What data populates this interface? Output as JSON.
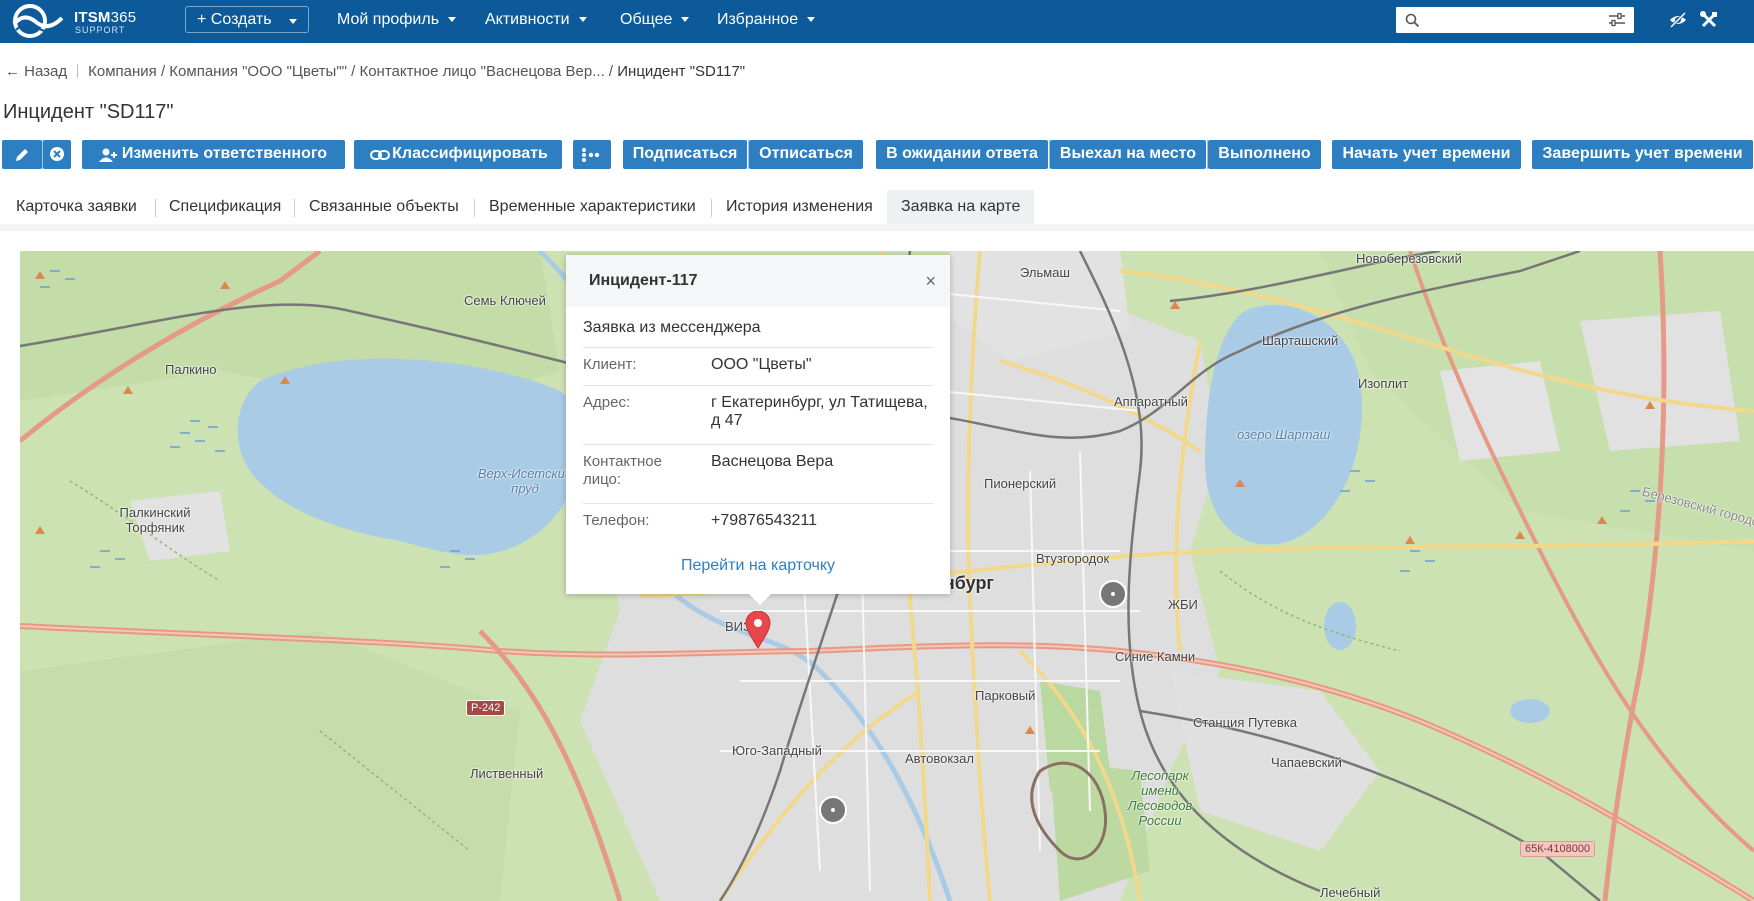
{
  "header": {
    "brand": "ITSM",
    "brand_num": "365",
    "brand_sub": "SUPPORT",
    "create_label": "+ Создать",
    "nav": [
      "Мой профиль",
      "Активности",
      "Общее",
      "Избранное"
    ],
    "search_placeholder": ""
  },
  "breadcrumb": {
    "back": "← Назад",
    "path": "Компания / Компания \"ООО \"Цветы\"\" / Контактное лицо \"Васнецова Вер... / ",
    "current": "Инцидент \"SD117\""
  },
  "page_title": "Инцидент \"SD117\"",
  "toolbar": {
    "change_responsible": "Изменить ответственного",
    "classify": "Классифицировать",
    "subscribe": "Подписаться",
    "unsubscribe": "Отписаться",
    "awaiting_response": "В ожидании ответа",
    "went_on_site": "Выехал на место",
    "done": "Выполнено",
    "start_time": "Начать учет времени",
    "stop_time": "Завершить учет времени"
  },
  "tabs": [
    "Карточка заявки",
    "Спецификация",
    "Связанные объекты",
    "Временные характеристики",
    "История изменения",
    "Заявка на карте"
  ],
  "active_tab": "Заявка на карте",
  "popup": {
    "title": "Инцидент-117",
    "subtitle": "Заявка из мессенджера",
    "close": "×",
    "rows": [
      {
        "label": "Клиент:",
        "value": "ООО \"Цветы\""
      },
      {
        "label": "Адрес:",
        "value": "г Екатеринбург, ул Татищева, д 47"
      },
      {
        "label": "Контактное лицо:",
        "value": "Васнецова Вера"
      },
      {
        "label": "Телефон:",
        "value": "+79876543211"
      }
    ],
    "link": "Перейти на карточку"
  },
  "map": {
    "labels": {
      "elmash": "Эльмаш",
      "novoberezovsky": "Новоберезовский",
      "sem_klyuchei": "Семь Ключей",
      "palkino": "Палкино",
      "shartashsky": "Шарташский",
      "izoplit": "Изоплит",
      "apparatny": "Аппаратный",
      "ozero_shartash": "озеро Шарташ",
      "verkh_isetsky": "Верх-Исетский пруд",
      "pionersky": "Пионерский",
      "berezovsky_okrug": "Березовский городской о",
      "palkinsky_torfyanik": "Палкинский Торфяник",
      "vtuzgorodok": "Втузгородок",
      "ekaterinburg": "Екатеринбург",
      "zhbi": "ЖБИ",
      "viz": "ВИЗ",
      "sinie_kamni": "Синие Камни",
      "parkovy": "Парковый",
      "stantsiya_putevka": "Станция Путевка",
      "yugo_zapadny": "Юго-Западный",
      "avtovokzal": "Автовокзал",
      "chapaevsky": "Чапаевский",
      "listvenny": "Лиственный",
      "lesopark": "Лесопарк имени Лесоводов России",
      "lechebny": "Лечебный"
    },
    "road_tags": {
      "r242": "Р-242",
      "k65": "65К-4108000"
    }
  }
}
